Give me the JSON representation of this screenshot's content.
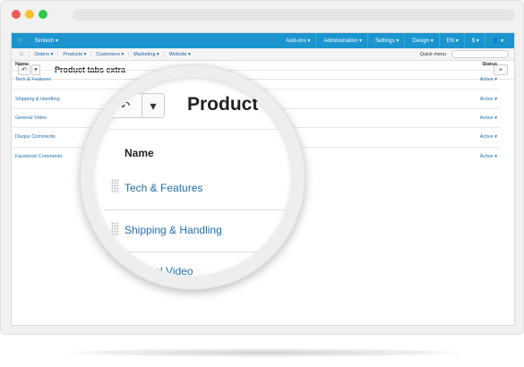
{
  "colors": {
    "topbar": "#1c95cf",
    "link": "#1e6fb0",
    "dot_red": "#f25a58",
    "dot_yellow": "#f5c22d",
    "dot_green": "#2ec84a"
  },
  "topbar": {
    "brand": "Simtech",
    "items": [
      "Add-ons",
      "Administration",
      "Settings",
      "Design",
      "EN",
      "$"
    ],
    "user_icon": "user-icon"
  },
  "subnav": {
    "home_icon": "home-icon",
    "items": [
      "Orders",
      "Products",
      "Customers",
      "Marketing",
      "Website"
    ],
    "quick_menu": "Quick menu"
  },
  "page": {
    "title": "Product tabs extra",
    "back_icon": "back-arrow-icon",
    "add_icon": "plus-icon"
  },
  "table": {
    "headers": {
      "name": "Name",
      "status": "Status"
    },
    "rows": [
      {
        "name": "Tech & Features",
        "status": "Active"
      },
      {
        "name": "Shipping & Handling",
        "status": "Active"
      },
      {
        "name": "General Video",
        "status": "Active"
      },
      {
        "name": "Disqus Comments",
        "status": "Active"
      },
      {
        "name": "Facebook Comments",
        "status": "Active"
      }
    ]
  },
  "zoom": {
    "title": "Product",
    "header": "Name",
    "rows": [
      "Tech & Features",
      "Shipping & Handling",
      "General Video"
    ]
  }
}
